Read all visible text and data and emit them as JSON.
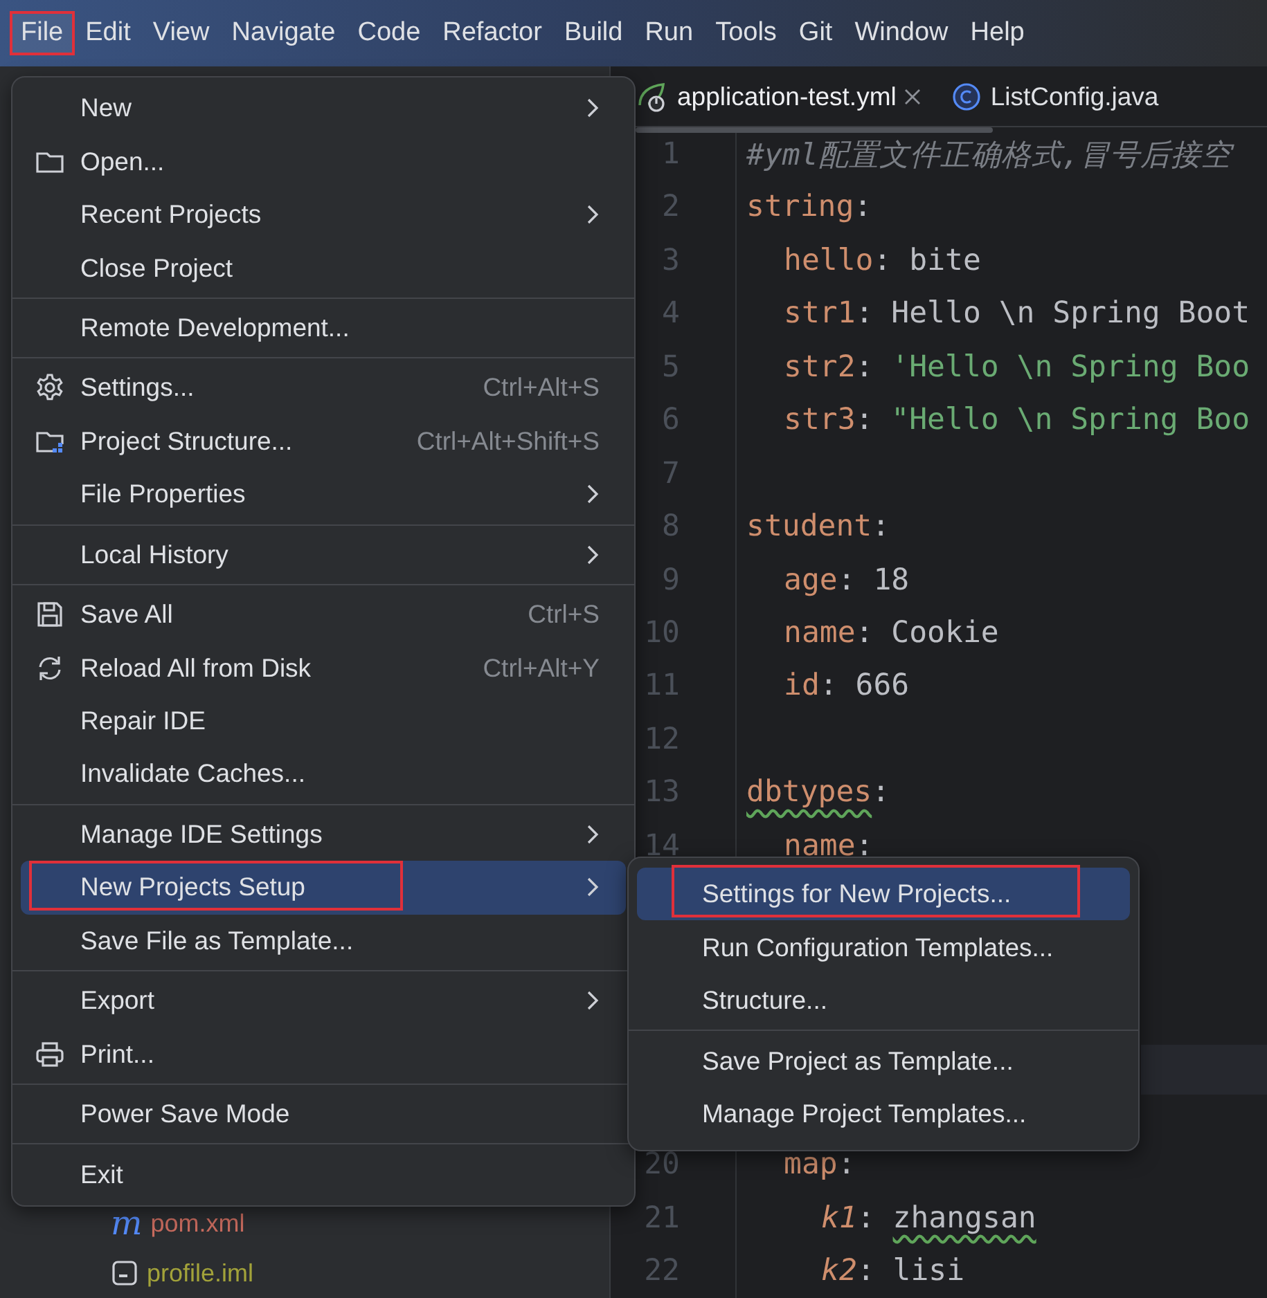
{
  "menubar": [
    {
      "label": "File",
      "annotated": true,
      "selected": true
    },
    {
      "label": "Edit",
      "annotated": false,
      "selected": false
    },
    {
      "label": "View",
      "annotated": false,
      "selected": false
    },
    {
      "label": "Navigate",
      "annotated": false,
      "selected": false
    },
    {
      "label": "Code",
      "annotated": false,
      "selected": false
    },
    {
      "label": "Refactor",
      "annotated": false,
      "selected": false
    },
    {
      "label": "Build",
      "annotated": false,
      "selected": false
    },
    {
      "label": "Run",
      "annotated": false,
      "selected": false
    },
    {
      "label": "Tools",
      "annotated": false,
      "selected": false
    },
    {
      "label": "Git",
      "annotated": false,
      "selected": false
    },
    {
      "label": "Window",
      "annotated": false,
      "selected": false
    },
    {
      "label": "Help",
      "annotated": false,
      "selected": false
    }
  ],
  "project_tree": [
    {
      "kind": "maven",
      "icon_text": "m",
      "label": "pom.xml",
      "color": "#c86b5e"
    },
    {
      "kind": "module",
      "label": "profile.iml",
      "color": "#a3a33a"
    }
  ],
  "editor": {
    "tabs": [
      {
        "label": "application-test.yml",
        "kind": "yaml",
        "selected": true,
        "closable": true
      },
      {
        "label": "ListConfig.java",
        "kind": "java",
        "selected": false,
        "closable": false
      }
    ],
    "lines": [
      {
        "number": "1",
        "kind": "top",
        "tokens": [
          {
            "text": "#yml配置文件正确格式,冒号后接空",
            "kind": "comment",
            "typo": false
          }
        ]
      },
      {
        "number": "2",
        "kind": "top",
        "tokens": [
          {
            "text": "string",
            "kind": "key",
            "typo": false
          },
          {
            "text": ":",
            "kind": "punct",
            "typo": false
          }
        ]
      },
      {
        "number": "3",
        "kind": "nested",
        "tokens": [
          {
            "text": "hello",
            "kind": "key",
            "typo": false
          },
          {
            "text": ": ",
            "kind": "punct",
            "typo": false
          },
          {
            "text": "bite",
            "kind": "plain",
            "typo": false
          }
        ]
      },
      {
        "number": "4",
        "kind": "nested",
        "tokens": [
          {
            "text": "str1",
            "kind": "key",
            "typo": false
          },
          {
            "text": ": ",
            "kind": "punct",
            "typo": false
          },
          {
            "text": "Hello \\n Spring Boot",
            "kind": "plain",
            "typo": false
          }
        ]
      },
      {
        "number": "5",
        "kind": "nested",
        "tokens": [
          {
            "text": "str2",
            "kind": "key",
            "typo": false
          },
          {
            "text": ": ",
            "kind": "punct",
            "typo": false
          },
          {
            "text": "'Hello \\n Spring Boo",
            "kind": "string",
            "typo": false
          }
        ]
      },
      {
        "number": "6",
        "kind": "nested",
        "tokens": [
          {
            "text": "str3",
            "kind": "key",
            "typo": false
          },
          {
            "text": ": ",
            "kind": "punct",
            "typo": false
          },
          {
            "text": "\"Hello \\n Spring Boo",
            "kind": "string",
            "typo": false
          }
        ]
      },
      {
        "number": "7",
        "kind": "blank"
      },
      {
        "number": "8",
        "kind": "top",
        "tokens": [
          {
            "text": "student",
            "kind": "key",
            "typo": false
          },
          {
            "text": ":",
            "kind": "punct",
            "typo": false
          }
        ]
      },
      {
        "number": "9",
        "kind": "nested",
        "tokens": [
          {
            "text": "age",
            "kind": "key",
            "typo": false
          },
          {
            "text": ": ",
            "kind": "punct",
            "typo": false
          },
          {
            "text": "18",
            "kind": "plain",
            "typo": false
          }
        ]
      },
      {
        "number": "10",
        "kind": "nested",
        "tokens": [
          {
            "text": "name",
            "kind": "key",
            "typo": false
          },
          {
            "text": ": ",
            "kind": "punct",
            "typo": false
          },
          {
            "text": "Cookie",
            "kind": "plain",
            "typo": false
          }
        ]
      },
      {
        "number": "11",
        "kind": "nested",
        "tokens": [
          {
            "text": "id",
            "kind": "key",
            "typo": false
          },
          {
            "text": ": ",
            "kind": "punct",
            "typo": false
          },
          {
            "text": "666",
            "kind": "plain",
            "typo": false
          }
        ]
      },
      {
        "number": "12",
        "kind": "blank"
      },
      {
        "number": "13",
        "kind": "top",
        "tokens": [
          {
            "text": "dbtypes",
            "kind": "key",
            "typo": true
          },
          {
            "text": ":",
            "kind": "punct",
            "typo": false
          }
        ]
      },
      {
        "number": "14",
        "kind": "nested",
        "tokens": [
          {
            "text": "name",
            "kind": "key"
          },
          {
            "text": ":",
            "kind": "punct"
          }
        ]
      },
      {
        "number": "20",
        "kind": "nested",
        "tokens": [
          {
            "text": "map",
            "kind": "key",
            "typo": false
          },
          {
            "text": ":",
            "kind": "punct",
            "typo": false
          }
        ]
      },
      {
        "number": "21",
        "kind": "deep",
        "tokens": [
          {
            "text": "k1",
            "kind": "italic-key",
            "typo": false
          },
          {
            "text": ": ",
            "kind": "punct",
            "typo": false
          },
          {
            "text": "zhangsan",
            "kind": "plain",
            "typo": true
          }
        ]
      },
      {
        "number": "22",
        "kind": "deep",
        "tokens": [
          {
            "text": "k2",
            "kind": "italic-key",
            "typo": false
          },
          {
            "text": ": ",
            "kind": "punct",
            "typo": false
          },
          {
            "text": "lisi",
            "kind": "plain",
            "typo": false
          }
        ]
      }
    ]
  },
  "file_menu": {
    "groups": [
      {
        "items": [
          {
            "label": "New",
            "kind": "plain",
            "submenu": true,
            "selected": false,
            "annotated": false
          },
          {
            "label": "Open...",
            "kind": "open",
            "submenu": false,
            "selected": false,
            "annotated": false
          },
          {
            "label": "Recent Projects",
            "kind": "plain",
            "submenu": true,
            "selected": false,
            "annotated": false
          },
          {
            "label": "Close Project",
            "kind": "plain",
            "submenu": false,
            "selected": false,
            "annotated": false
          }
        ]
      },
      {
        "items": [
          {
            "label": "Remote Development...",
            "kind": "plain",
            "submenu": false,
            "selected": false,
            "annotated": false
          }
        ]
      },
      {
        "items": [
          {
            "label": "Settings...",
            "kind": "settings",
            "shortcut": "Ctrl+Alt+S",
            "submenu": false,
            "selected": false,
            "annotated": false
          },
          {
            "label": "Project Structure...",
            "kind": "structure",
            "shortcut": "Ctrl+Alt+Shift+S",
            "submenu": false,
            "selected": false,
            "annotated": false
          },
          {
            "label": "File Properties",
            "kind": "plain",
            "submenu": true,
            "selected": false,
            "annotated": false
          }
        ]
      },
      {
        "items": [
          {
            "label": "Local History",
            "kind": "plain",
            "submenu": true,
            "selected": false,
            "annotated": false
          }
        ]
      },
      {
        "items": [
          {
            "label": "Save All",
            "kind": "save",
            "shortcut": "Ctrl+S",
            "submenu": false,
            "selected": false,
            "annotated": false
          },
          {
            "label": "Reload All from Disk",
            "kind": "reload",
            "shortcut": "Ctrl+Alt+Y",
            "submenu": false,
            "selected": false,
            "annotated": false
          },
          {
            "label": "Repair IDE",
            "kind": "plain",
            "submenu": false,
            "selected": false,
            "annotated": false
          },
          {
            "label": "Invalidate Caches...",
            "kind": "plain",
            "submenu": false,
            "selected": false,
            "annotated": false
          }
        ]
      },
      {
        "items": [
          {
            "label": "Manage IDE Settings",
            "kind": "plain",
            "submenu": true,
            "selected": false,
            "annotated": false
          },
          {
            "label": "New Projects Setup",
            "kind": "plain",
            "submenu": true,
            "selected": true,
            "annotated": true
          },
          {
            "label": "Save File as Template...",
            "kind": "plain",
            "submenu": false,
            "selected": false,
            "annotated": false
          }
        ]
      },
      {
        "items": [
          {
            "label": "Export",
            "kind": "plain",
            "submenu": true,
            "selected": false,
            "annotated": false
          },
          {
            "label": "Print...",
            "kind": "print",
            "submenu": false,
            "selected": false,
            "annotated": false
          }
        ]
      },
      {
        "items": [
          {
            "label": "Power Save Mode",
            "kind": "plain",
            "submenu": false,
            "selected": false,
            "annotated": false
          }
        ]
      },
      {
        "items": [
          {
            "label": "Exit",
            "kind": "plain",
            "submenu": false,
            "selected": false,
            "annotated": false
          }
        ]
      }
    ]
  },
  "submenu": {
    "groups": [
      {
        "items": [
          {
            "label": "Settings for New Projects...",
            "selected": true,
            "annotated": true
          },
          {
            "label": "Run Configuration Templates...",
            "selected": false,
            "annotated": false
          },
          {
            "label": "Structure...",
            "selected": false,
            "annotated": false
          }
        ]
      },
      {
        "items": [
          {
            "label": "Save Project as Template...",
            "selected": false,
            "annotated": false
          },
          {
            "label": "Manage Project Templates...",
            "selected": false,
            "annotated": false
          }
        ]
      }
    ]
  }
}
